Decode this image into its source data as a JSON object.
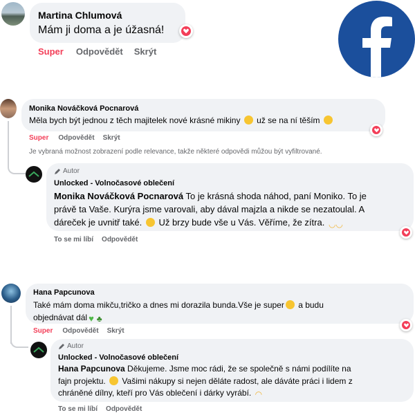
{
  "comments": [
    {
      "author": "Martina Chlumová",
      "text": "Mám ji doma a je úžasná!",
      "actions": {
        "like": "Super",
        "reply": "Odpovědět",
        "hide": "Skrýt"
      }
    },
    {
      "author": "Monika Nováčková Pocnarová",
      "text": "Měla bych být jednou z těch majitelek nové krásné mikiny",
      "text_after": "už se na ní těším",
      "actions": {
        "like": "Super",
        "reply": "Odpovědět",
        "hide": "Skrýt"
      },
      "note": "Je vybraná možnost zobrazení podle relevance, takže některé odpovědi můžou být vyfiltrované.",
      "reply": {
        "badge": "Autor",
        "author": "Unlocked - Volnočasové oblečení",
        "mention": "Monika Nováčková Pocnarová",
        "lines": [
          "To je krásná shoda náhod, paní Moniko. To je",
          "právě ta Vaše. Kurýra jsme varovali, aby dával majzla a nikde se nezatoulal. A",
          "dáreček je uvnitř také.",
          "Už brzy bude vše u Vás. Věříme, že zítra."
        ],
        "actions": {
          "like": "To se mi líbí",
          "reply": "Odpovědět"
        }
      }
    },
    {
      "author": "Hana Papcunova",
      "lines": [
        "Také mám doma mikču,tričko a dnes mi dorazila bunda.Vše je super",
        "a budu",
        "objednávat dál"
      ],
      "actions": {
        "like": "Super",
        "reply": "Odpovědět",
        "hide": "Skrýt"
      },
      "reply": {
        "badge": "Autor",
        "author": "Unlocked - Volnočasové oblečení",
        "mention": "Hana Papcunova",
        "lines": [
          "Děkujeme. Jsme moc rádi, že se společně s námi podílíte na",
          "fajn projektu.",
          "Vašimi nákupy si nejen děláte radost, ale dáváte práci i lidem z",
          "chráněné dílny, kteří pro Vás oblečení i dárky vyrábí."
        ],
        "actions": {
          "like": "To se mi líbí",
          "reply": "Odpovědět"
        }
      }
    }
  ],
  "colors": {
    "facebook_blue": "#1b4f9c",
    "bubble": "#f0f2f5",
    "super_red": "#f33e58",
    "meta_gray": "#65676b"
  },
  "icons": [
    "facebook-logo",
    "heart-reaction-icon",
    "pencil-icon"
  ]
}
